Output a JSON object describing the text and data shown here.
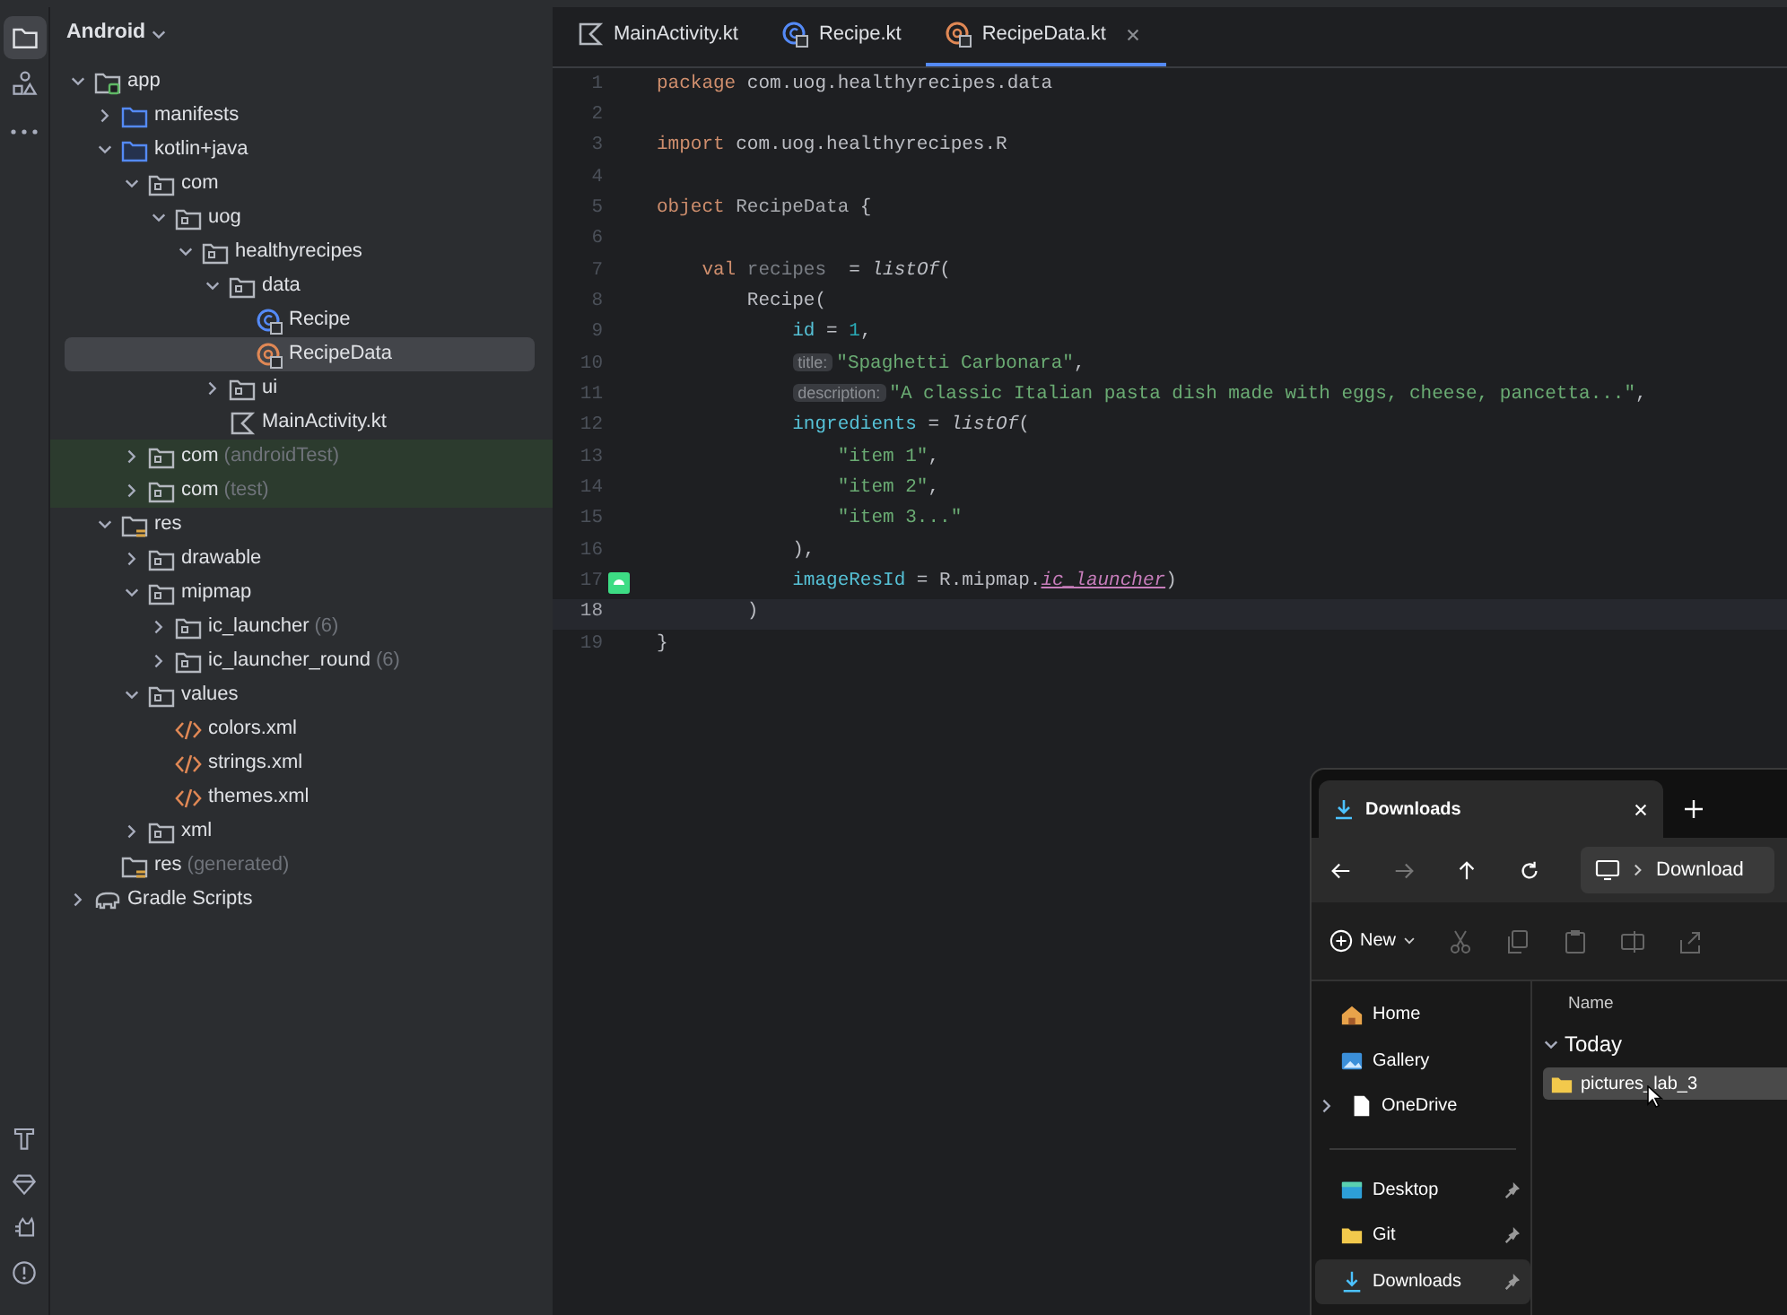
{
  "tool_windows": [
    {
      "kind": "project",
      "selected": true
    },
    {
      "kind": "resources",
      "selected": false
    },
    {
      "kind": "more",
      "selected": false
    }
  ],
  "bottom_tools": [
    {
      "kind": "build"
    },
    {
      "kind": "gem"
    },
    {
      "kind": "cat"
    },
    {
      "kind": "problems"
    }
  ],
  "project_panel": {
    "view": "Android"
  },
  "tree": [
    {
      "label": "app",
      "kind": "module",
      "expanded": true,
      "selected": false,
      "children": [
        {
          "label": "manifests",
          "kind": "source-folder",
          "expanded": false,
          "selected": false
        },
        {
          "label": "kotlin+java",
          "kind": "source-folder",
          "expanded": true,
          "selected": false,
          "children": [
            {
              "label": "com",
              "kind": "package",
              "expanded": true,
              "selected": false,
              "children": [
                {
                  "label": "uog",
                  "kind": "package",
                  "expanded": true,
                  "selected": false,
                  "children": [
                    {
                      "label": "healthyrecipes",
                      "kind": "package",
                      "expanded": true,
                      "selected": false,
                      "children": [
                        {
                          "label": "data",
                          "kind": "package",
                          "expanded": true,
                          "selected": false,
                          "children": [
                            {
                              "label": "Recipe",
                              "kind": "class",
                              "selected": false
                            },
                            {
                              "label": "RecipeData",
                              "kind": "object",
                              "selected": true
                            }
                          ]
                        },
                        {
                          "label": "ui",
                          "kind": "package",
                          "expanded": false,
                          "selected": false
                        },
                        {
                          "label": "MainActivity.kt",
                          "kind": "kotlin-file",
                          "selected": false
                        }
                      ]
                    }
                  ]
                }
              ]
            },
            {
              "label": "com",
              "suffix": "(androidTest)",
              "kind": "test-package",
              "expanded": false,
              "selected": false
            },
            {
              "label": "com",
              "suffix": "(test)",
              "kind": "test-package",
              "expanded": false,
              "selected": false
            }
          ]
        },
        {
          "label": "res",
          "kind": "res-folder",
          "expanded": true,
          "selected": false,
          "children": [
            {
              "label": "drawable",
              "kind": "package",
              "expanded": false,
              "selected": false
            },
            {
              "label": "mipmap",
              "kind": "package",
              "expanded": true,
              "selected": false,
              "children": [
                {
                  "label": "ic_launcher",
                  "suffix": "(6)",
                  "kind": "package",
                  "expanded": false,
                  "selected": false
                },
                {
                  "label": "ic_launcher_round",
                  "suffix": "(6)",
                  "kind": "package",
                  "expanded": false,
                  "selected": false
                }
              ]
            },
            {
              "label": "values",
              "kind": "package",
              "expanded": true,
              "selected": false,
              "children": [
                {
                  "label": "colors.xml",
                  "kind": "xml",
                  "selected": false
                },
                {
                  "label": "strings.xml",
                  "kind": "xml",
                  "selected": false
                },
                {
                  "label": "themes.xml",
                  "kind": "xml",
                  "selected": false
                }
              ]
            },
            {
              "label": "xml",
              "kind": "package",
              "expanded": false,
              "selected": false
            }
          ]
        },
        {
          "label": "res",
          "suffix": "(generated)",
          "kind": "res-folder",
          "selected": false
        }
      ]
    },
    {
      "label": "Gradle Scripts",
      "kind": "gradle",
      "expanded": false,
      "selected": false
    }
  ],
  "editor_tabs": [
    {
      "label": "MainActivity.kt",
      "kind": "kotlin-file",
      "selected": false
    },
    {
      "label": "Recipe.kt",
      "kind": "class",
      "selected": false
    },
    {
      "label": "RecipeData.kt",
      "kind": "object",
      "selected": true
    }
  ],
  "code_lines": [
    {
      "number": "1",
      "current": false,
      "tokens": [
        {
          "kind": "keyword",
          "text": "package"
        },
        {
          "kind": "plain",
          "text": " com.uog.healthyrecipes.data"
        }
      ]
    },
    {
      "number": "2",
      "current": false
    },
    {
      "number": "3",
      "current": false,
      "tokens": [
        {
          "kind": "keyword",
          "text": "import"
        },
        {
          "kind": "plain",
          "text": " com.uog.healthyrecipes.R"
        }
      ]
    },
    {
      "number": "4",
      "current": false
    },
    {
      "number": "5",
      "current": false,
      "tokens": [
        {
          "kind": "keyword",
          "text": "object"
        },
        {
          "kind": "dim",
          "text": " RecipeData"
        },
        {
          "kind": "plain",
          "text": " {"
        }
      ]
    },
    {
      "number": "6",
      "current": false
    },
    {
      "number": "7",
      "current": false,
      "tokens": [
        {
          "kind": "keyword",
          "text": "    val"
        },
        {
          "kind": "unused",
          "text": " recipes"
        },
        {
          "kind": "plain",
          "text": "  = "
        },
        {
          "kind": "function",
          "text": "listOf"
        },
        {
          "kind": "plain",
          "text": "("
        }
      ]
    },
    {
      "number": "8",
      "current": false,
      "tokens": [
        {
          "kind": "plain",
          "text": "        Recipe("
        }
      ]
    },
    {
      "number": "9",
      "current": false,
      "tokens": [
        {
          "kind": "property",
          "text": "            id"
        },
        {
          "kind": "plain",
          "text": " = "
        },
        {
          "kind": "number",
          "text": "1"
        },
        {
          "kind": "plain",
          "text": ","
        }
      ]
    },
    {
      "number": "10",
      "current": false,
      "tokens": [
        {
          "kind": "hint",
          "text": "            title:"
        },
        {
          "kind": "string",
          "text": "\"Spaghetti Carbonara\""
        },
        {
          "kind": "plain",
          "text": ","
        }
      ]
    },
    {
      "number": "11",
      "current": false,
      "tokens": [
        {
          "kind": "hint",
          "text": "            description:"
        },
        {
          "kind": "string",
          "text": "\"A classic Italian pasta dish made with eggs, cheese, pancetta...\""
        },
        {
          "kind": "plain",
          "text": ","
        }
      ]
    },
    {
      "number": "12",
      "current": false,
      "tokens": [
        {
          "kind": "property",
          "text": "            ingredients"
        },
        {
          "kind": "plain",
          "text": " = "
        },
        {
          "kind": "function",
          "text": "listOf"
        },
        {
          "kind": "plain",
          "text": "("
        }
      ]
    },
    {
      "number": "13",
      "current": false,
      "tokens": [
        {
          "kind": "string",
          "text": "                \"item 1\""
        },
        {
          "kind": "plain",
          "text": ","
        }
      ]
    },
    {
      "number": "14",
      "current": false,
      "tokens": [
        {
          "kind": "string",
          "text": "                \"item 2\""
        },
        {
          "kind": "plain",
          "text": ","
        }
      ]
    },
    {
      "number": "15",
      "current": false,
      "tokens": [
        {
          "kind": "string",
          "text": "                \"item 3...\""
        }
      ]
    },
    {
      "number": "16",
      "current": false,
      "tokens": [
        {
          "kind": "plain",
          "text": "            ),"
        }
      ]
    },
    {
      "number": "17",
      "current": false,
      "gutter_preview": true,
      "tokens": [
        {
          "kind": "property",
          "text": "            imageResId"
        },
        {
          "kind": "plain",
          "text": " = R.mipmap."
        },
        {
          "kind": "reference",
          "text": "ic_launcher"
        },
        {
          "kind": "plain",
          "text": ")"
        }
      ]
    },
    {
      "number": "18",
      "current": true,
      "tokens": [
        {
          "kind": "plain",
          "text": "        )"
        }
      ]
    },
    {
      "number": "19",
      "current": false,
      "tokens": [
        {
          "kind": "plain",
          "text": "}"
        }
      ]
    }
  ],
  "explorer": {
    "tab_title": "Downloads",
    "path": "Download",
    "new_button": "New",
    "sidebar": [
      {
        "label": "Home",
        "kind": "home",
        "pinned": false,
        "selected": false
      },
      {
        "label": "Gallery",
        "kind": "gallery",
        "pinned": false,
        "selected": false
      },
      {
        "label": "OneDrive",
        "kind": "cloud-file",
        "expanded": false,
        "pinned": false,
        "selected": false
      },
      {
        "kind": "divider"
      },
      {
        "label": "Desktop",
        "kind": "desktop",
        "pinned": true,
        "selected": false
      },
      {
        "label": "Git",
        "kind": "folder",
        "pinned": true,
        "selected": false
      },
      {
        "label": "Downloads",
        "kind": "download",
        "pinned": true,
        "selected": true
      }
    ],
    "column": "Name",
    "group": "Today",
    "files": [
      {
        "label": "pictures_lab_3",
        "kind": "folder",
        "selected": true
      }
    ]
  }
}
